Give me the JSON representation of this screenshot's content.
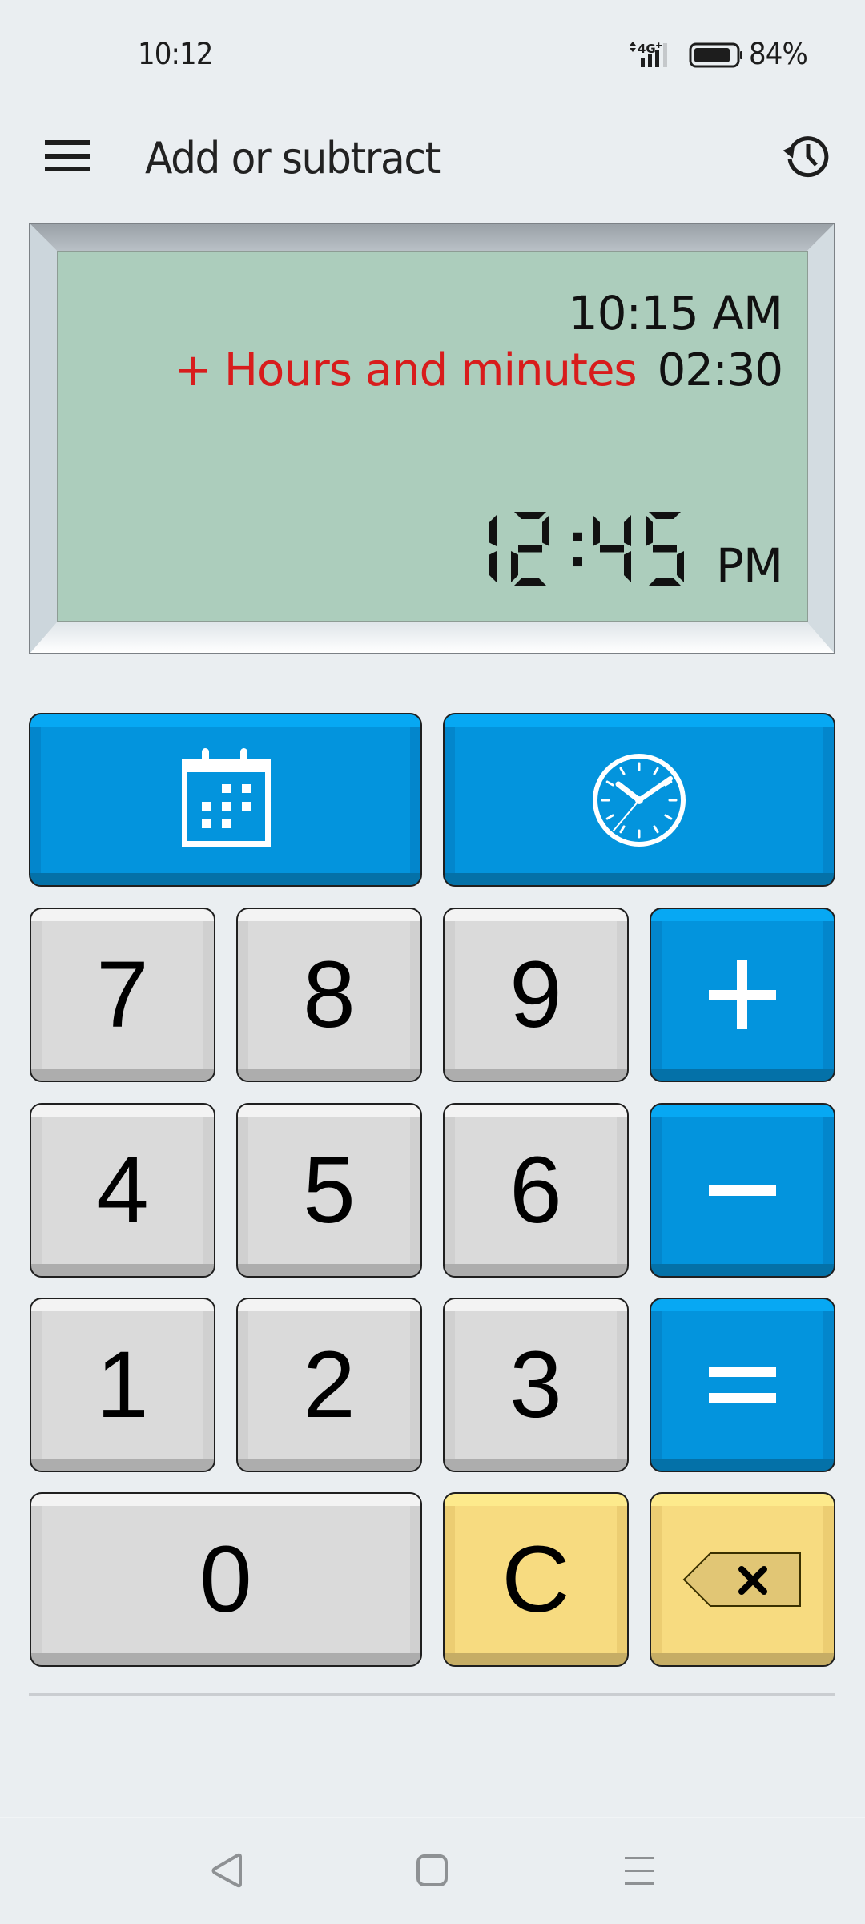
{
  "status_bar": {
    "time": "10:12",
    "network": "4G+",
    "battery_percent": 84,
    "battery_text": "84%"
  },
  "header": {
    "title": "Add or subtract",
    "menu_icon": "hamburger-menu-icon",
    "history_icon": "history-icon"
  },
  "display": {
    "start_time": "10:15 AM",
    "operation_label": "+ Hours and minutes",
    "operand": "02:30",
    "result_digits": "12:45",
    "result_ampm": "PM",
    "colors": {
      "lcd": "#accdbc",
      "operation": "#d81c1c"
    }
  },
  "mode_buttons": [
    {
      "name": "date-mode-button",
      "icon": "calendar-icon"
    },
    {
      "name": "time-mode-button",
      "icon": "clock-icon"
    }
  ],
  "keypad": {
    "rows": [
      [
        {
          "label": "7",
          "style": "gray"
        },
        {
          "label": "8",
          "style": "gray"
        },
        {
          "label": "9",
          "style": "gray"
        },
        {
          "label": "+",
          "style": "blue",
          "name": "plus"
        }
      ],
      [
        {
          "label": "4",
          "style": "gray"
        },
        {
          "label": "5",
          "style": "gray"
        },
        {
          "label": "6",
          "style": "gray"
        },
        {
          "label": "−",
          "style": "blue",
          "name": "minus"
        }
      ],
      [
        {
          "label": "1",
          "style": "gray"
        },
        {
          "label": "2",
          "style": "gray"
        },
        {
          "label": "3",
          "style": "gray"
        },
        {
          "label": "=",
          "style": "blue",
          "name": "equals"
        }
      ],
      [
        {
          "label": "0",
          "style": "gray",
          "span": 2
        },
        {
          "label": "C",
          "style": "yellow",
          "name": "clear"
        },
        {
          "label": "",
          "style": "yellow",
          "name": "backspace",
          "icon": "backspace-icon"
        }
      ]
    ],
    "colors": {
      "gray": "#dadada",
      "blue": "#0394dd",
      "yellow": "#f7db80"
    }
  },
  "nav_bar": {
    "back_icon": "back-triangle-icon",
    "home_icon": "home-square-icon",
    "recents_icon": "recents-lines-icon"
  }
}
